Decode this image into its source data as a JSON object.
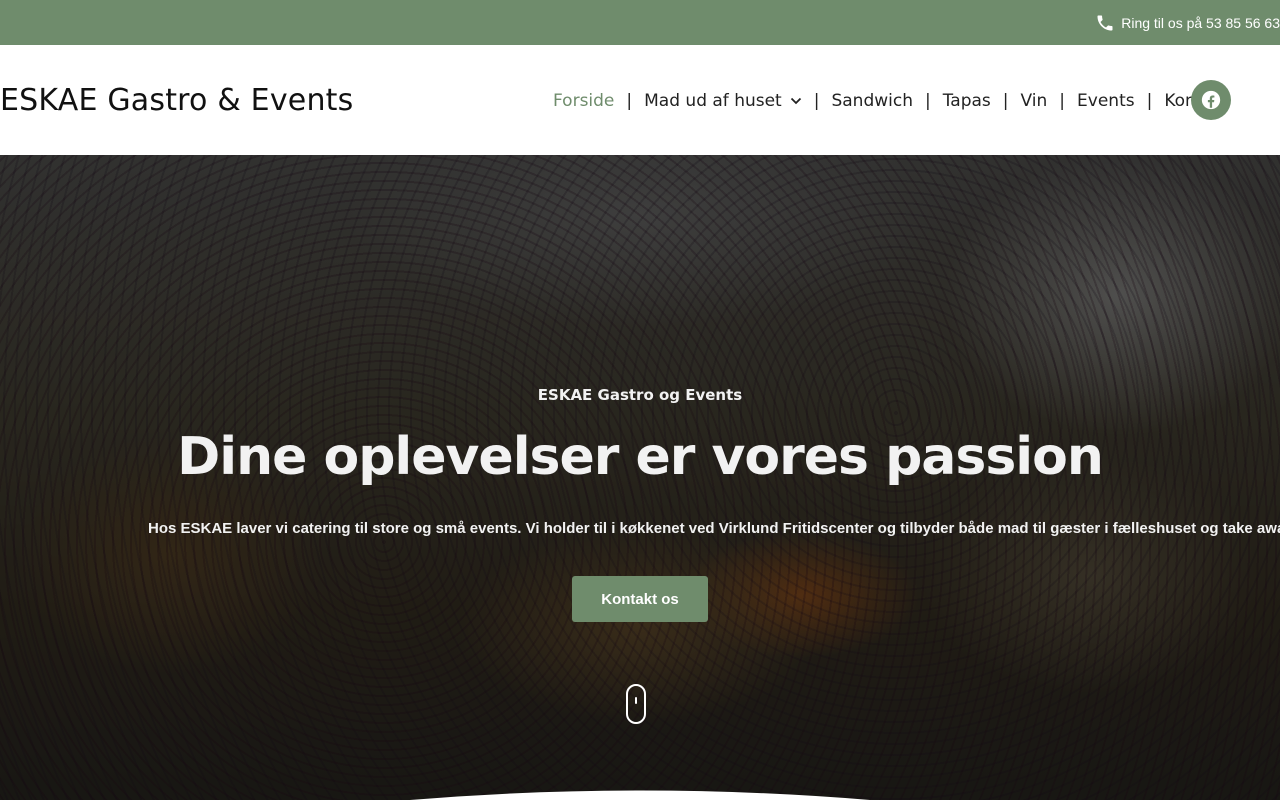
{
  "topbar": {
    "phone_text": "Ring til os på 53 85 56 63",
    "phone_icon": "phone-icon"
  },
  "header": {
    "logo": "ESKAE Gastro & Events",
    "nav": [
      {
        "label": "Forside",
        "active": true
      },
      {
        "label": "Mad ud af huset",
        "has_dropdown": true
      },
      {
        "label": "Sandwich"
      },
      {
        "label": "Tapas"
      },
      {
        "label": "Vin"
      },
      {
        "label": "Events"
      },
      {
        "label": "Kontakt"
      }
    ],
    "social_icon": "facebook-icon"
  },
  "hero": {
    "eyebrow": "ESKAE Gastro og Events",
    "headline": "Dine oplevelser er vores passion",
    "lead": "Hos ESKAE laver vi catering til store og små events. Vi holder til i køkkenet ved Virklund Fritidscenter og tilbyder både mad til gæster i fælleshuset og take away.",
    "cta_label": "Kontakt os",
    "scroll_icon": "mouse-scroll-icon"
  },
  "colors": {
    "accent": "#6f8c6c",
    "header_bg": "#ffffff",
    "text_dark": "#222222",
    "hero_text": "#f2f2f2"
  }
}
